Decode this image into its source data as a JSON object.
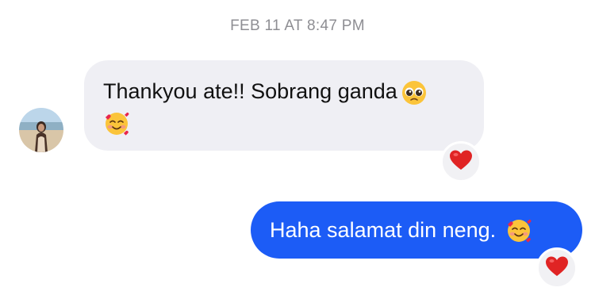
{
  "timestamp": "FEB 11 AT 8:47 PM",
  "messages": [
    {
      "direction": "incoming",
      "text": "Thankyou ate!! Sobrang ganda",
      "emojis": [
        "pleading-face-emoji",
        "smiling-face-with-hearts-emoji"
      ],
      "reaction": "red-heart"
    },
    {
      "direction": "outgoing",
      "text": "Haha salamat din neng.",
      "emojis": [
        "smiling-face-with-hearts-emoji"
      ],
      "reaction": "red-heart"
    }
  ],
  "colors": {
    "incoming_bubble": "#efeff4",
    "outgoing_bubble": "#1c5cf6",
    "timestamp_text": "#8e8e93",
    "heart": "#e02424"
  }
}
